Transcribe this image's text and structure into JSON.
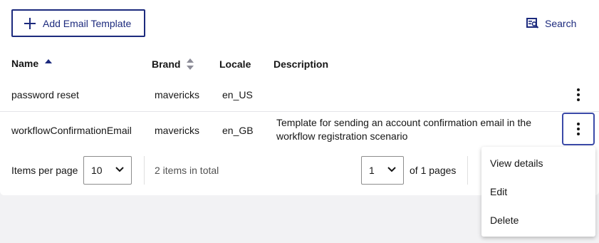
{
  "toolbar": {
    "add_label": "Add Email Template",
    "search_label": "Search"
  },
  "table": {
    "columns": {
      "name": "Name",
      "brand": "Brand",
      "locale": "Locale",
      "description": "Description"
    },
    "sort": {
      "column": "name",
      "direction": "ascending"
    },
    "rows": [
      {
        "name": "password reset",
        "brand": "mavericks",
        "locale": "en_US",
        "description_line1": "",
        "description_line2": ""
      },
      {
        "name": "workflowConfirmationEmail",
        "brand": "mavericks",
        "locale": "en_GB",
        "description_line1": "Template for sending an account confirmation email in the",
        "description_line2": "workflow registration scenario"
      }
    ]
  },
  "pagination": {
    "items_per_page_label": "Items per page",
    "items_per_page_value": "10",
    "total_text": "2 items in total",
    "page_value": "1",
    "pages_text": "of 1 pages"
  },
  "row_menu": {
    "items": [
      "View details",
      "Edit",
      "Delete"
    ]
  },
  "colors": {
    "accent": "#1c2a7d",
    "focus_border": "#3b4aa8",
    "background": "#f2f2f4",
    "panel": "#ffffff"
  }
}
